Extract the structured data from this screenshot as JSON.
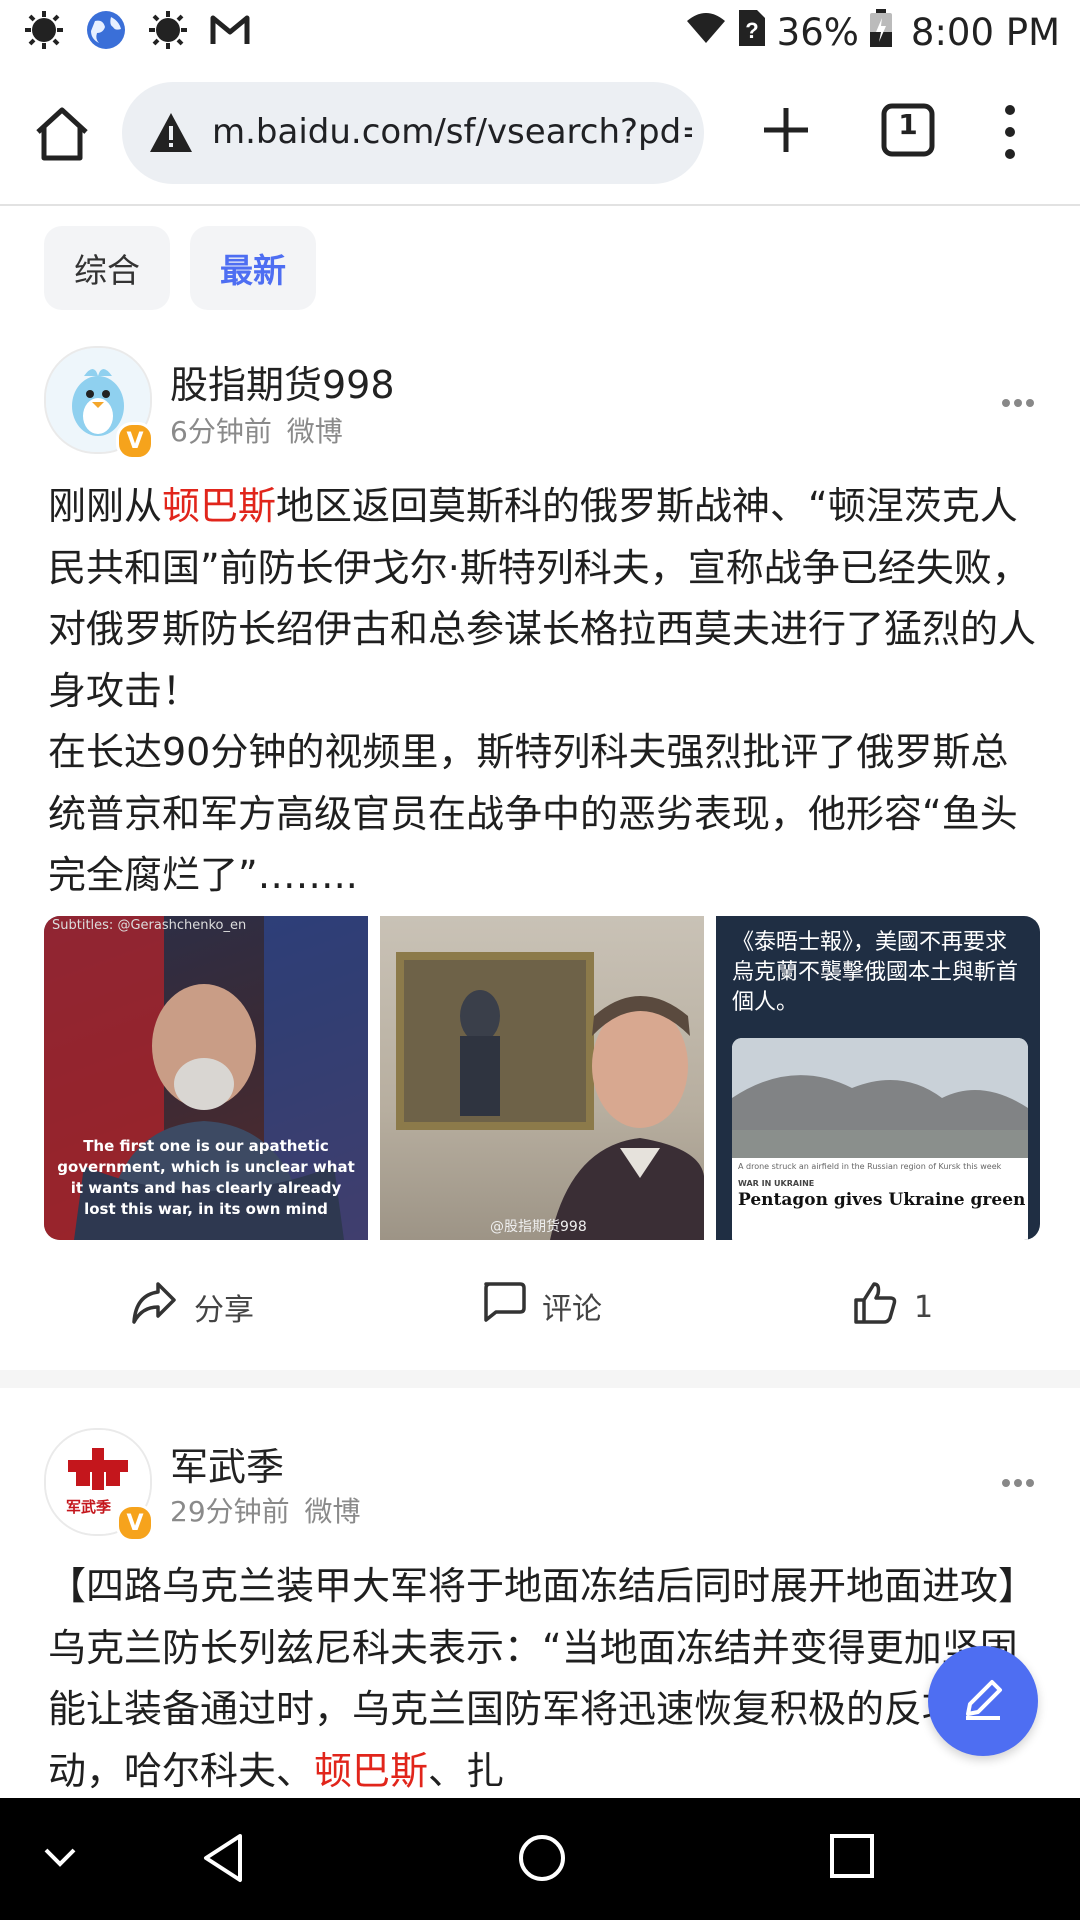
{
  "status_bar": {
    "battery": "36%",
    "time": "8:00 PM",
    "left_icons": [
      "brightness-icon",
      "globe-icon",
      "brightness-icon",
      "gmail-icon"
    ],
    "right_icons": [
      "wifi-icon",
      "no-sim-icon",
      "battery-charging-icon"
    ]
  },
  "browser": {
    "url": "m.baidu.com/sf/vsearch?pd=r",
    "tab_count": "1"
  },
  "filters": {
    "tabs": [
      {
        "label": "综合",
        "active": false
      },
      {
        "label": "最新",
        "active": true
      }
    ]
  },
  "posts": [
    {
      "author": "股指期货998",
      "time": "6分钟前",
      "source": "微博",
      "badge": "V",
      "text_before": "刚刚从",
      "text_highlight": "顿巴斯",
      "text_after": "地区返回莫斯科的俄罗斯战神、“顿涅茨克人民共和国”前防长伊戈尔·斯特列科夫，宣称战争已经失败，对俄罗斯防长绍伊古和总参谋长格拉西莫夫进行了猛烈的人身攻击！",
      "text_para2": "在长达90分钟的视频里，斯特列科夫强烈批评了俄罗斯总统普京和军方高级官员在战争中的恶劣表现，他形容“鱼头完全腐烂了”……..",
      "images": {
        "img1_sub": "Subtitles: @Gerashchenko_en",
        "img1_caption": "The first one is our apathetic government, which is unclear what it wants and has clearly already lost this war, in its own mind",
        "img2_watermark": "@股指期货998",
        "img3_title": "《泰晤士報》，美國不再要求烏克蘭不襲擊俄國本土與斬首個人。",
        "img3_photo_caption": "A drone struck an airfield in the Russian region of Kursk this week",
        "img3_section": "WAR IN UKRAINE",
        "img3_headline": "Pentagon gives Ukraine green"
      },
      "actions": {
        "share": "分享",
        "comment": "评论",
        "like_count": "1"
      }
    },
    {
      "author": "军武季",
      "time": "29分钟前",
      "source": "微博",
      "badge": "V",
      "avatar_text": "军武季",
      "text_before": "【四路乌克兰装甲大军将于地面冻结后同时展开地面进攻】乌克兰防长列兹尼科夫表示：“当地面冻结并变得更加坚固能让装备通过时，乌克兰国防军将迅速恢复积极的反攻行动，哈尔科夫、",
      "text_highlight": "顿巴斯",
      "text_after": "、扎"
    }
  ]
}
